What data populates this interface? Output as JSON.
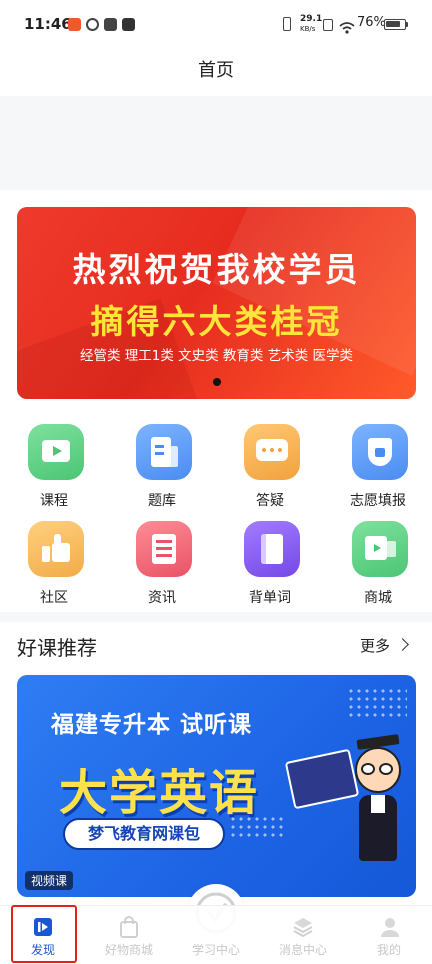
{
  "status_bar": {
    "time": "11:46",
    "net_speed_value": "29.1",
    "net_speed_unit": "KB/s",
    "battery": "76%"
  },
  "header": {
    "title": "首页"
  },
  "banner": {
    "line1": "热烈祝贺我校学员",
    "line2": "摘得六大类桂冠",
    "line3": "经管类 理工1类 文史类 教育类 艺术类 医学类"
  },
  "grid": [
    {
      "label": "课程",
      "icon": "tv-icon",
      "color": "#5fcf82"
    },
    {
      "label": "题库",
      "icon": "document-icon",
      "color": "#5c9cf5"
    },
    {
      "label": "答疑",
      "icon": "chat-icon",
      "color": "#f5b35a"
    },
    {
      "label": "志愿填报",
      "icon": "flag-icon",
      "color": "#5c9cf5"
    },
    {
      "label": "社区",
      "icon": "thumbs-up-icon",
      "color": "#f5b35a"
    },
    {
      "label": "资讯",
      "icon": "news-icon",
      "color": "#ef6a7a"
    },
    {
      "label": "背单词",
      "icon": "book-icon",
      "color": "#8a62ef"
    },
    {
      "label": "商城",
      "icon": "store-icon",
      "color": "#5fcf82"
    }
  ],
  "recommend": {
    "title": "好课推荐",
    "more": "更多",
    "course": {
      "top_text": "福建专升本  试听课",
      "main_text": "大学英语",
      "pill_text": "梦飞教育网课包",
      "badge": "视频课"
    }
  },
  "bottom_nav": [
    {
      "label": "发现",
      "icon": "discover-icon"
    },
    {
      "label": "好物商城",
      "icon": "shopping-bag-icon"
    },
    {
      "label": "学习中心",
      "icon": "check-circle-icon"
    },
    {
      "label": "消息中心",
      "icon": "layers-icon"
    },
    {
      "label": "我的",
      "icon": "user-icon"
    }
  ],
  "colors": {
    "accent": "#1a56d6",
    "highlight_box": "#e2231a",
    "banner_red": "#e62c1f",
    "banner_yellow": "#ffe53a"
  }
}
